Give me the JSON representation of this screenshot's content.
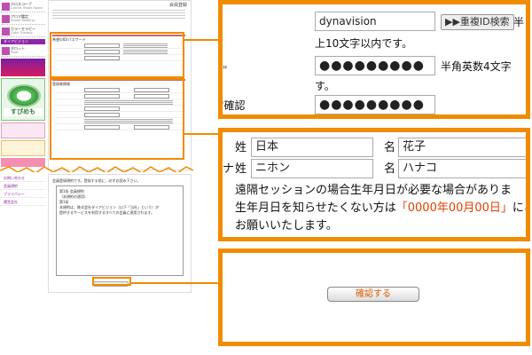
{
  "colors": {
    "accent": "#f08c00",
    "sidebar_purple": "#8e24aa",
    "highlight_text": "#e04000"
  },
  "mini": {
    "page_title": "会員登録",
    "sidebar_items": [
      {
        "title": "ホロスコープ",
        "sub": "Cosmic Vision Space"
      },
      {
        "title": "アロマ鑑定",
        "sub": "Aroma Reading"
      },
      {
        "title": "カラーセラピー",
        "sub": "Color Therapy"
      },
      {
        "title": "タロット",
        "sub": "Tarot"
      }
    ],
    "sidebar_head": "ダイアビジョン",
    "banner_text": "すぴめも",
    "section1_heading": "希望のID/パスワード",
    "section2_heading": "登録者情報",
    "lower_links": [
      "お問い合わせ",
      "会員規約",
      "プライバシー",
      "運営会社"
    ],
    "lower_tag": "会員登録規約です。登録する前に、必ずお読み下さい。",
    "terms_lines": [
      "第1条 会員規約",
      "（本規約の適用）",
      "第1条",
      "本規約は、株式会社ダイアビジョン（以下「当社」という）が",
      "提供するサービスを利用するすべての会員に適用されます。"
    ]
  },
  "panel1": {
    "id_value": "dynavision",
    "dup_button": "▶▶重複ID検索",
    "side_char": "半",
    "id_note": "上10文字以内です。",
    "password_dots": "●●●●●●●●●",
    "pw_note": "半角英数4文字",
    "pw_note_tail": "す。",
    "confirm_label": "確認",
    "confirm_dots": "●●●●●●●●●"
  },
  "panel2": {
    "sei_label": "姓",
    "sei_value": "日本",
    "mei_label": "名",
    "mei_value": "花子",
    "kana_prefix": "ナ",
    "sei_kana_label": "姓",
    "sei_kana_value": "ニホン",
    "mei_kana_label": "名",
    "mei_kana_value": "ハナコ",
    "note_line1": "遠隔セッションの場合生年月日が必要な場合がありま",
    "note_line2_pre": "生年月日を知らせたくない方は",
    "note_line2_highlight": "「0000年00月00日」",
    "note_line2_post": "にご",
    "note_line3": "お願いいたします。"
  },
  "panel3": {
    "confirm_button": "確認する"
  }
}
